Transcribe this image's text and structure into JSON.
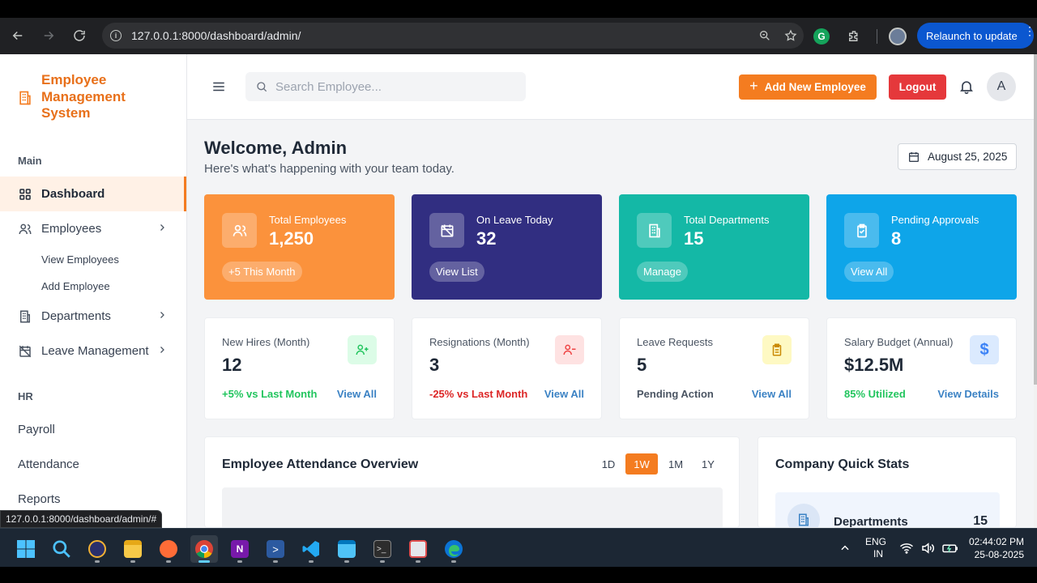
{
  "browser": {
    "url": "127.0.0.1:8000/dashboard/admin/",
    "relaunch_label": "Relaunch to update",
    "status_url": "127.0.0.1:8000/dashboard/admin/#"
  },
  "brand": {
    "name": "Employee Management System",
    "color": "#f47c20"
  },
  "sidebar": {
    "section_main": "Main",
    "section_hr": "HR",
    "items": [
      {
        "label": "Dashboard",
        "icon": "grid-icon",
        "active": true
      },
      {
        "label": "Employees",
        "icon": "users-icon"
      },
      {
        "label": "View Employees"
      },
      {
        "label": "Add Employee"
      },
      {
        "label": "Departments",
        "icon": "building-icon"
      },
      {
        "label": "Leave Management",
        "icon": "calendar-x-icon"
      },
      {
        "label": "Payroll"
      },
      {
        "label": "Attendance"
      },
      {
        "label": "Reports"
      }
    ]
  },
  "topbar": {
    "search_placeholder": "Search Employee...",
    "add_label": "Add New Employee",
    "logout_label": "Logout",
    "avatar_initial": "A"
  },
  "header": {
    "title": "Welcome, Admin",
    "subtitle": "Here's what's happening with your team today.",
    "date": "August 25, 2025"
  },
  "stats": [
    {
      "label": "Total Employees",
      "value": "1,250",
      "pill": "+5 This Month",
      "color": "#fb923c"
    },
    {
      "label": "On Leave Today",
      "value": "32",
      "pill": "View List",
      "color": "#312e81"
    },
    {
      "label": "Total Departments",
      "value": "15",
      "pill": "Manage",
      "color": "#14b8a6"
    },
    {
      "label": "Pending Approvals",
      "value": "8",
      "pill": "View All",
      "color": "#0ea5e9"
    }
  ],
  "cards": [
    {
      "label": "New Hires (Month)",
      "value": "12",
      "foot": "+5% vs Last Month",
      "link": "View All"
    },
    {
      "label": "Resignations (Month)",
      "value": "3",
      "foot": "-25% vs Last Month",
      "link": "View All"
    },
    {
      "label": "Leave Requests",
      "value": "5",
      "foot": "Pending Action",
      "link": "View All"
    },
    {
      "label": "Salary Budget (Annual)",
      "value": "$12.5M",
      "foot": "85% Utilized",
      "link": "View Details"
    }
  ],
  "attendance": {
    "title": "Employee Attendance Overview",
    "ranges": [
      "1D",
      "1W",
      "1M",
      "1Y"
    ],
    "selected": "1W"
  },
  "quick_stats": {
    "title": "Company Quick Stats",
    "rows": [
      {
        "label": "Departments",
        "value": "15"
      }
    ]
  },
  "taskbar": {
    "lang1": "ENG",
    "lang2": "IN",
    "time": "02:44:02 PM",
    "date": "25-08-2025"
  }
}
